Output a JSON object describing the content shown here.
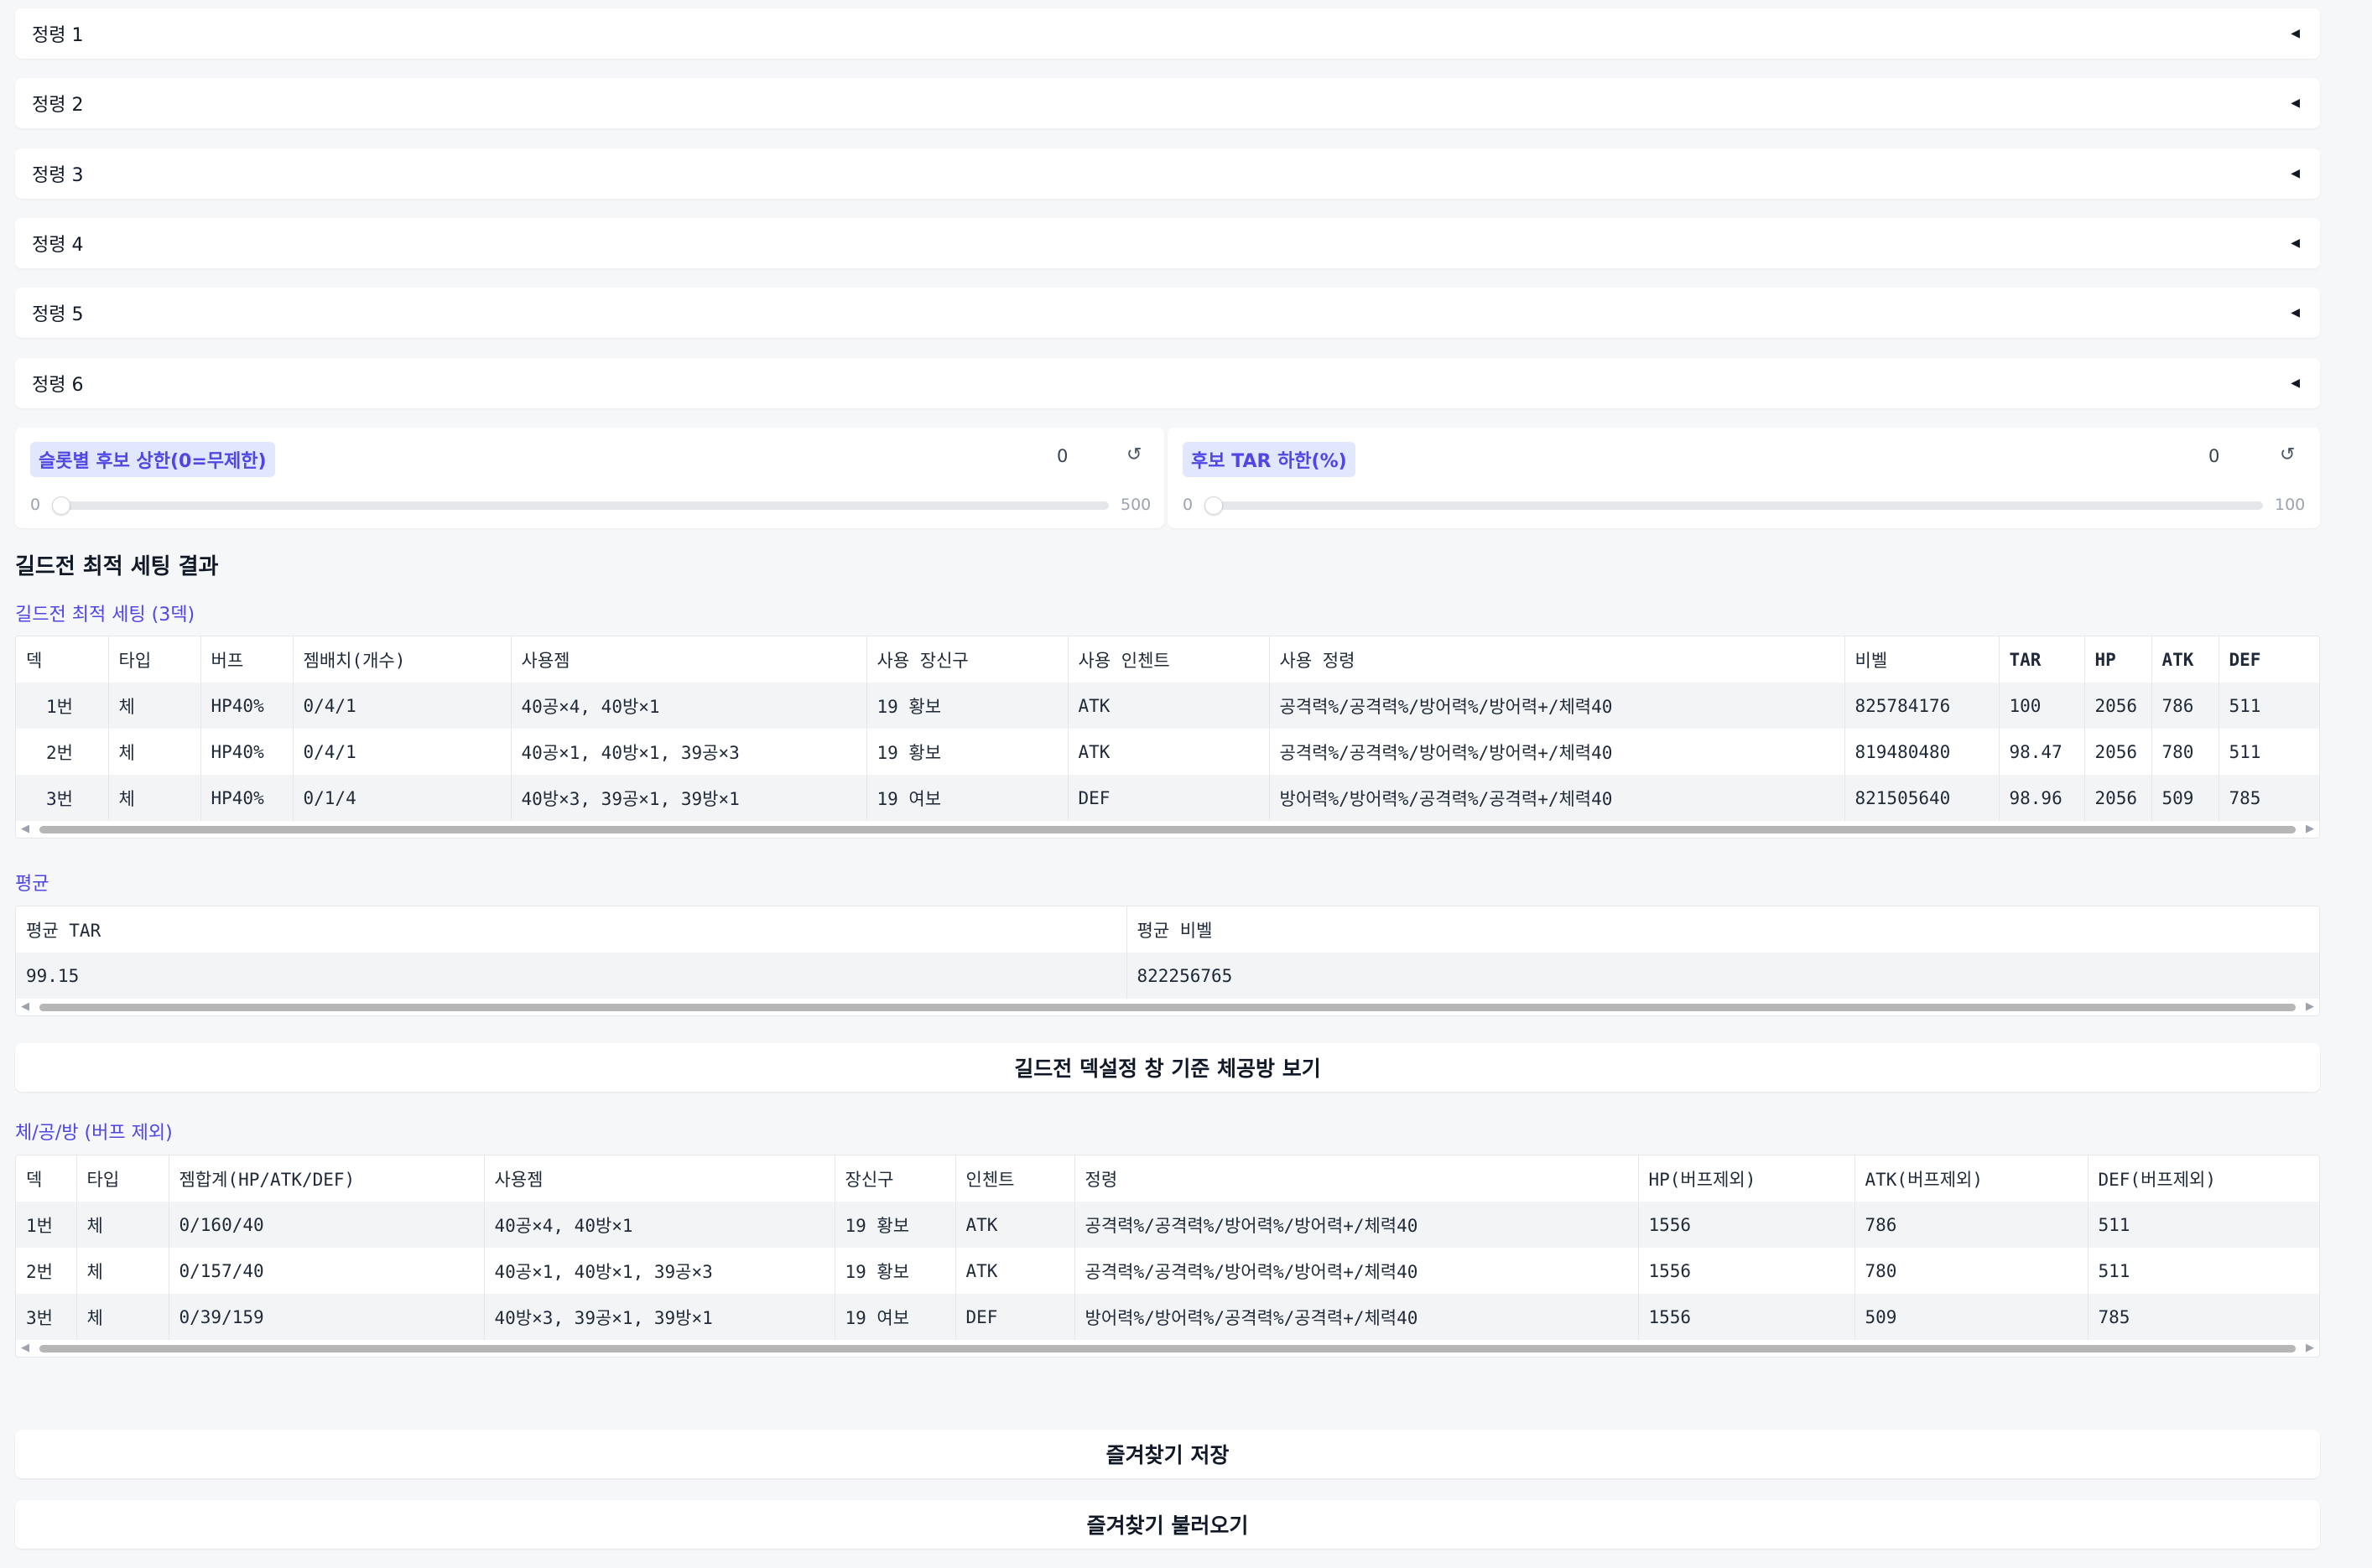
{
  "accordions": [
    {
      "label": "정령 1"
    },
    {
      "label": "정령 2"
    },
    {
      "label": "정령 3"
    },
    {
      "label": "정령 4"
    },
    {
      "label": "정령 5"
    },
    {
      "label": "정령 6"
    }
  ],
  "accordion_caret": "◀",
  "sliders": [
    {
      "label": "슬롯별 후보 상한(0=무제한)",
      "value": "0",
      "min": "0",
      "max": "500",
      "reset_icon": "↺",
      "level_fraction": 0
    },
    {
      "label": "후보 TAR 하한(%)",
      "value": "0",
      "min": "0",
      "max": "100",
      "reset_icon": "↺",
      "level_fraction": 0
    }
  ],
  "results_title": "길드전 최적 세팅 결과",
  "deck_table": {
    "label": "길드전 최적 세팅 (3덱)",
    "headers": [
      "덱",
      "타입",
      "버프",
      "젬배치(개수)",
      "사용젬",
      "사용 장신구",
      "사용 인첸트",
      "사용 정령",
      "비벨",
      "TAR",
      "HP",
      "ATK",
      "DEF"
    ],
    "rows": [
      [
        "1번",
        "체",
        "HP40%",
        "0/4/1",
        "40공×4, 40방×1",
        "19 황보",
        "ATK",
        "공격력%/공격력%/방어력%/방어력+/체력40",
        "825784176",
        "100",
        "2056",
        "786",
        "511"
      ],
      [
        "2번",
        "체",
        "HP40%",
        "0/4/1",
        "40공×1, 40방×1, 39공×3",
        "19 황보",
        "ATK",
        "공격력%/공격력%/방어력%/방어력+/체력40",
        "819480480",
        "98.47",
        "2056",
        "780",
        "511"
      ],
      [
        "3번",
        "체",
        "HP40%",
        "0/1/4",
        "40방×3, 39공×1, 39방×1",
        "19 여보",
        "DEF",
        "방어력%/방어력%/공격력%/공격력+/체력40",
        "821505640",
        "98.96",
        "2056",
        "509",
        "785"
      ]
    ]
  },
  "avg_table": {
    "label": "평균",
    "headers": [
      "평균 TAR",
      "평균 비벨"
    ],
    "rows": [
      [
        "99.15",
        "822256765"
      ]
    ]
  },
  "view_button": "길드전 덱설정 창 기준 체공방 보기",
  "stat_table": {
    "label": "체/공/방 (버프 제외)",
    "headers": [
      "덱",
      "타입",
      "젬합계(HP/ATK/DEF)",
      "사용젬",
      "장신구",
      "인첸트",
      "정령",
      "HP(버프제외)",
      "ATK(버프제외)",
      "DEF(버프제외)"
    ],
    "rows": [
      [
        "1번",
        "체",
        "0/160/40",
        "40공×4, 40방×1",
        "19 황보",
        "ATK",
        "공격력%/공격력%/방어력%/방어력+/체력40",
        "1556",
        "786",
        "511"
      ],
      [
        "2번",
        "체",
        "0/157/40",
        "40공×1, 40방×1, 39공×3",
        "19 황보",
        "ATK",
        "공격력%/공격력%/방어력%/방어력+/체력40",
        "1556",
        "780",
        "511"
      ],
      [
        "3번",
        "체",
        "0/39/159",
        "40방×3, 39공×1, 39방×1",
        "19 여보",
        "DEF",
        "방어력%/방어력%/공격력%/공격력+/체력40",
        "1556",
        "509",
        "785"
      ]
    ]
  },
  "save_button": "즐겨찾기 저장",
  "load_button": "즐겨찾기 불러오기",
  "scroll_left": "◀",
  "scroll_right": "▶"
}
